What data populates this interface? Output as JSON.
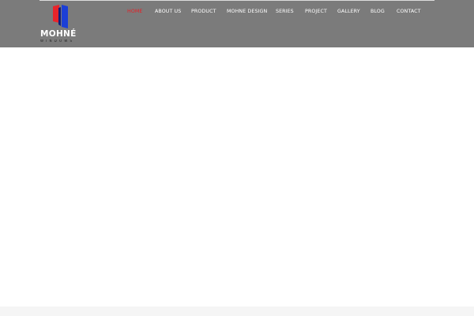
{
  "brand": {
    "name": "MOHNÉ",
    "tagline": "WINDOWS",
    "colors": {
      "header_bg": "#7b7b7b",
      "active_nav": "#e81e25",
      "logo_red": "#e8242a",
      "logo_blue": "#1b3fd6",
      "logo_dark_blue": "#0f1f7a"
    },
    "logo_icon": "mohne-logo-mark"
  },
  "nav": {
    "items": [
      {
        "label": "HOME",
        "active": true
      },
      {
        "label": "ABOUT US",
        "active": false
      },
      {
        "label": "PRODUCT",
        "active": false
      },
      {
        "label": "MOHNE DESIGN",
        "active": false
      },
      {
        "label": "SERIES",
        "active": false
      },
      {
        "label": "PROJECT",
        "active": false
      },
      {
        "label": "GALLERY",
        "active": false
      },
      {
        "label": "BLOG",
        "active": false
      },
      {
        "label": "CONTACT",
        "active": false
      }
    ]
  }
}
